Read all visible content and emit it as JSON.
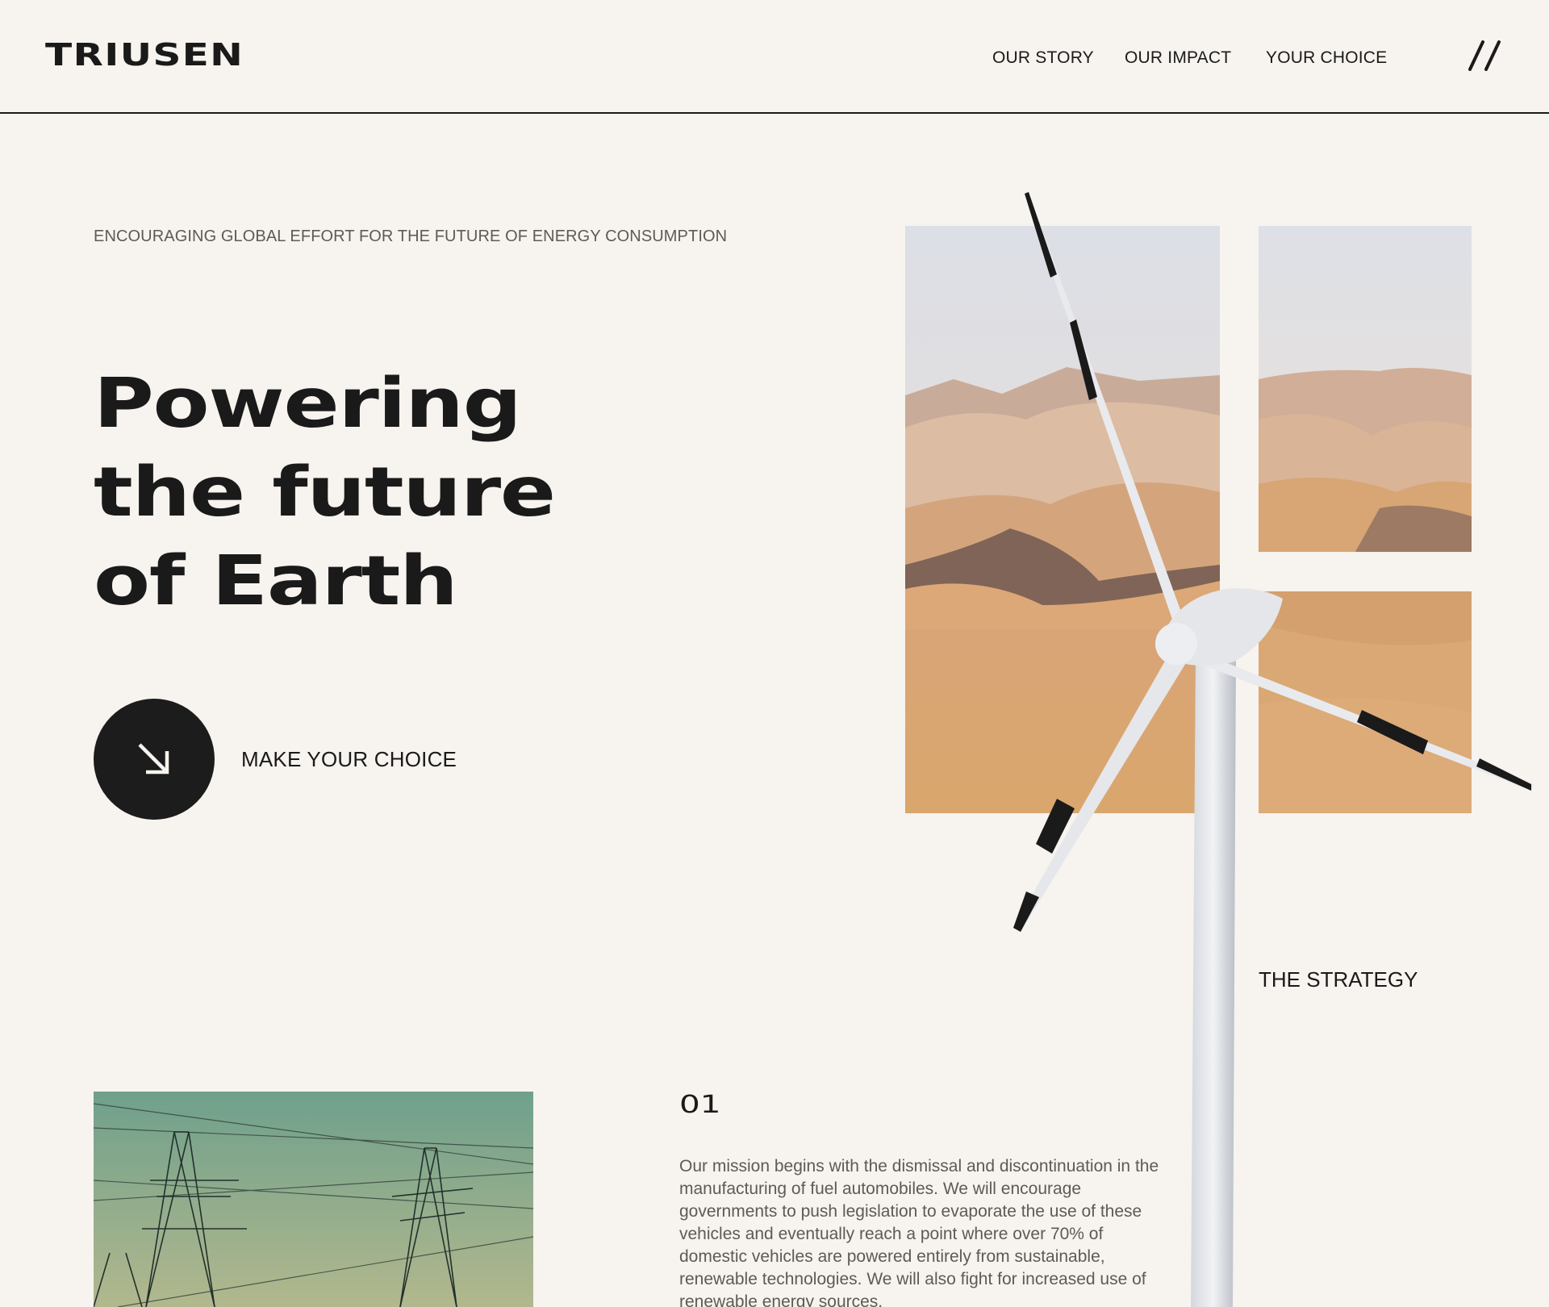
{
  "header": {
    "logo": "TRIUSEN",
    "nav": [
      {
        "label": "OUR STORY"
      },
      {
        "label": "OUR IMPACT"
      },
      {
        "label": "YOUR CHOICE"
      }
    ],
    "menu_icon": "double-slash-menu-icon"
  },
  "hero": {
    "eyebrow": "ENCOURAGING GLOBAL EFFORT FOR THE FUTURE OF ENERGY CONSUMPTION",
    "headline": [
      "Powering",
      "the future",
      "of Earth"
    ],
    "cta_label": "MAKE YOUR CHOICE",
    "cta_icon": "arrow-down-right-icon"
  },
  "strategy": {
    "label": "THE STRATEGY",
    "number": "01",
    "text": "Our mission begins with the dismissal and discontinuation in the manufacturing of fuel automobiles. We will encourage governments to push legislation to evaporate the use of these vehicles and eventually reach a point where over 70% of domestic vehicles are powered entirely from sustainable, renewable technologies. We will also fight for increased use of renewable energy sources."
  },
  "colors": {
    "background": "#f7f3ee",
    "ink": "#1a1a1a",
    "muted": "#5e5a56"
  }
}
